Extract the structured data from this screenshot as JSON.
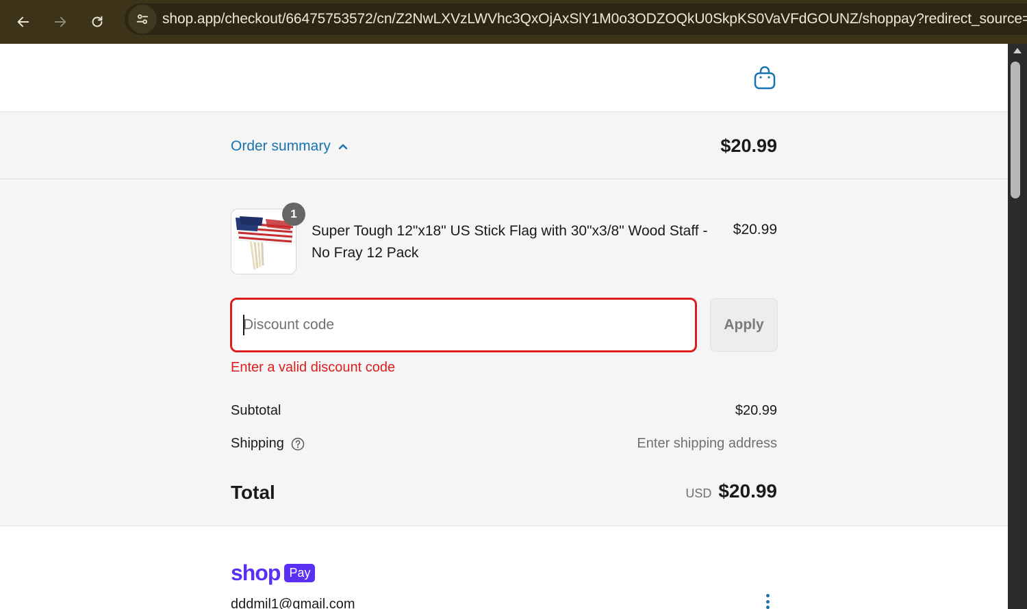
{
  "browser": {
    "url": "shop.app/checkout/66475753572/cn/Z2NwLXVzLWVhc3QxOjAxSlY1M0o3ODZOQkU0SkpKS0VaVFdGOUNZ/shoppay?redirect_source=c",
    "back_icon": "arrow-left-icon",
    "forward_icon": "arrow-right-icon",
    "reload_icon": "reload-icon",
    "site_info_icon": "tune-icon"
  },
  "header": {
    "cart_icon": "shopping-bag-icon"
  },
  "order_summary": {
    "toggle_label": "Order summary",
    "total": "$20.99"
  },
  "line_items": [
    {
      "quantity": "1",
      "name": "Super Tough 12\"x18\" US Stick Flag with 30\"x3/8\" Wood Staff - No Fray 12 Pack",
      "price": "$20.99"
    }
  ],
  "discount": {
    "placeholder": "Discount code",
    "value": "",
    "apply_label": "Apply",
    "error": "Enter a valid discount code"
  },
  "totals": {
    "subtotal_label": "Subtotal",
    "subtotal_value": "$20.99",
    "shipping_label": "Shipping",
    "shipping_value": "Enter shipping address",
    "total_label": "Total",
    "currency": "USD",
    "total_value": "$20.99"
  },
  "shop_pay": {
    "brand": "shop",
    "pill": "Pay",
    "email": "dddmil1@gmail.com"
  },
  "colors": {
    "link": "#1773b0",
    "error": "#dd1d1d",
    "shop_purple": "#5a31f4"
  }
}
